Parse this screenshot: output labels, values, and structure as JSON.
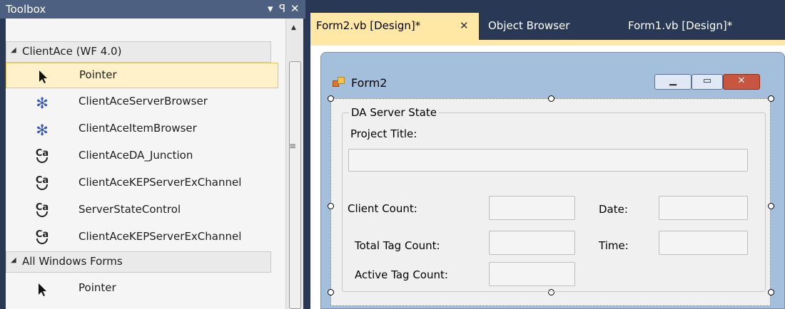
{
  "toolbox": {
    "title": "Toolbox",
    "controls": {
      "dropdown": "▾",
      "pin": "ꟼ",
      "close": "✕"
    },
    "categories": [
      {
        "label": "ClientAce (WF 4.0)",
        "items": [
          {
            "label": "Pointer",
            "icon": "pointer-icon",
            "selected": true
          },
          {
            "label": "ClientAceServerBrowser",
            "icon": "gear-icon"
          },
          {
            "label": "ClientAceItemBrowser",
            "icon": "gear-icon"
          },
          {
            "label": "ClientAceDA_Junction",
            "icon": "clientace-icon"
          },
          {
            "label": "ClientAceKEPServerExChannel",
            "icon": "clientace-icon"
          },
          {
            "label": "ServerStateControl",
            "icon": "clientace-icon"
          },
          {
            "label": "ClientAceKEPServerExChannel",
            "icon": "clientace-icon"
          }
        ]
      },
      {
        "label": "All Windows Forms",
        "items": [
          {
            "label": "Pointer",
            "icon": "pointer-icon"
          }
        ]
      }
    ]
  },
  "tabs": [
    {
      "label": "Form2.vb [Design]*",
      "active": true
    },
    {
      "label": "Object Browser",
      "active": false
    },
    {
      "label": "Form1.vb [Design]*",
      "active": false
    }
  ],
  "form": {
    "title": "Form2",
    "group_title": "DA Server State",
    "labels": {
      "project_title": "Project Title:",
      "client_count": "Client Count:",
      "date": "Date:",
      "total_tag_count": "Total Tag Count:",
      "time": "Time:",
      "active_tag_count": "Active Tag Count:"
    }
  },
  "colors": {
    "ide_background": "#293955",
    "active_tab": "#ffe8a6",
    "selection": "#fff1c9",
    "window_frame": "#a4bfdc",
    "close_button": "#c7553f"
  }
}
